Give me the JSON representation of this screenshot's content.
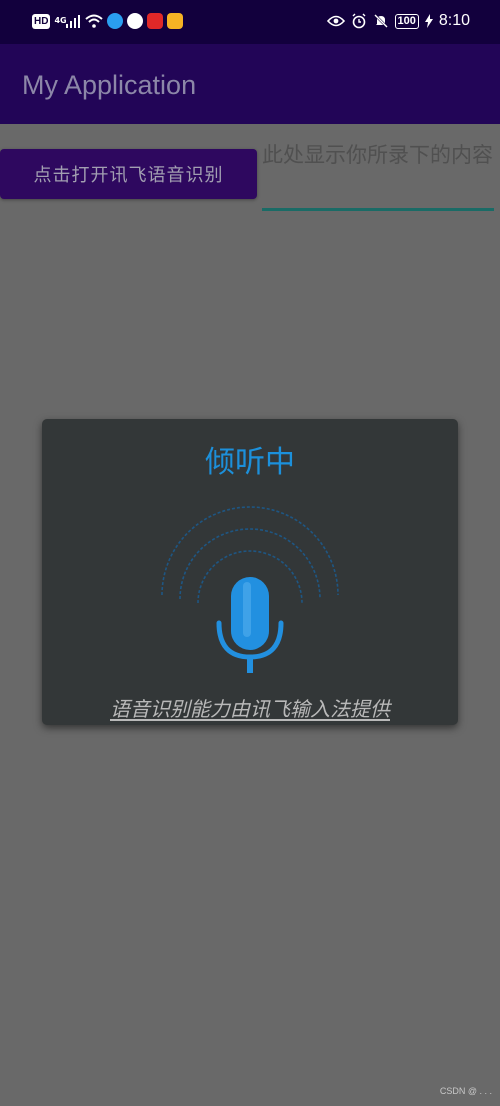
{
  "status_bar": {
    "left_badge": "HD",
    "network_label": "4G",
    "time": "8:10",
    "battery": "100",
    "colors": {
      "app1": "#2a9ef0",
      "app2": "#ffffff",
      "app3": "#e02828",
      "app4": "#f6b324"
    }
  },
  "app_bar": {
    "title": "My Application"
  },
  "main": {
    "voice_button_label": "点击打开讯飞语音识别",
    "result_text": "此处显示你所录下的内容"
  },
  "dialog": {
    "title": "倾听中",
    "provider_text": "语音识别能力由讯飞输入法提供"
  },
  "watermark": "CSDN @ .  .   ."
}
